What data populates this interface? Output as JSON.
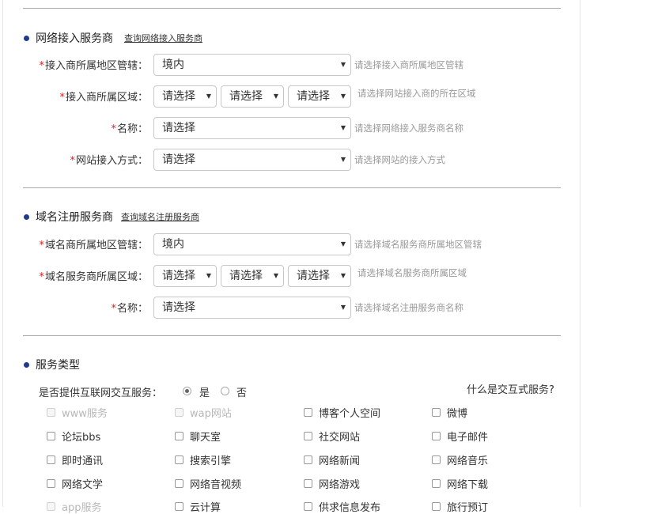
{
  "isp": {
    "title": "网络接入服务商",
    "link": "查询网络接入服务商",
    "rows": [
      {
        "label": "接入商所属地区管辖：",
        "value": "境内",
        "hint": "请选择接入商所属地区管辖"
      },
      {
        "label": "接入商所属区域：",
        "values": [
          "请选择",
          "请选择",
          "请选择"
        ],
        "hint": "请选择网站接入商的所在区域"
      },
      {
        "label": "名称：",
        "value": "请选择",
        "hint": "请选择网络接入服务商名称"
      },
      {
        "label": "网站接入方式：",
        "value": "请选择",
        "hint": "请选择网站的接入方式"
      }
    ]
  },
  "registrar": {
    "title": "域名注册服务商",
    "link": "查询域名注册服务商",
    "rows": [
      {
        "label": "域名商所属地区管辖：",
        "value": "境内",
        "hint": "请选择域名服务商所属地区管辖"
      },
      {
        "label": "域名服务商所属区域：",
        "values": [
          "请选择",
          "请选择",
          "请选择"
        ],
        "hint": "请选择域名服务商所属区域"
      },
      {
        "label": "名称：",
        "value": "请选择",
        "hint": "请选择域名注册服务商名称"
      }
    ]
  },
  "service": {
    "title": "服务类型",
    "question": "是否提供互联网交互服务：",
    "yes": "是",
    "no": "否",
    "selected": "yes",
    "what_link": "什么是交互式服务?",
    "options": [
      {
        "label": "www服务",
        "disabled": true
      },
      {
        "label": "wap网站",
        "disabled": true
      },
      {
        "label": "博客个人空间",
        "disabled": false
      },
      {
        "label": "微博",
        "disabled": false
      },
      {
        "label": "论坛bbs",
        "disabled": false
      },
      {
        "label": "聊天室",
        "disabled": false
      },
      {
        "label": "社交网站",
        "disabled": false
      },
      {
        "label": "电子邮件",
        "disabled": false
      },
      {
        "label": "即时通讯",
        "disabled": false
      },
      {
        "label": "搜索引擎",
        "disabled": false
      },
      {
        "label": "网络新闻",
        "disabled": false
      },
      {
        "label": "网络音乐",
        "disabled": false
      },
      {
        "label": "网络文学",
        "disabled": false
      },
      {
        "label": "网络音视频",
        "disabled": false
      },
      {
        "label": "网络游戏",
        "disabled": false
      },
      {
        "label": "网络下载",
        "disabled": false
      },
      {
        "label": "app服务",
        "disabled": true
      },
      {
        "label": "云计算",
        "disabled": false
      },
      {
        "label": "供求信息发布",
        "disabled": false
      },
      {
        "label": "旅行预订",
        "disabled": false
      }
    ]
  },
  "icons": {
    "select_arrow": "▼",
    "required_mark": "*",
    "bullet": "section-bullet-icon"
  }
}
